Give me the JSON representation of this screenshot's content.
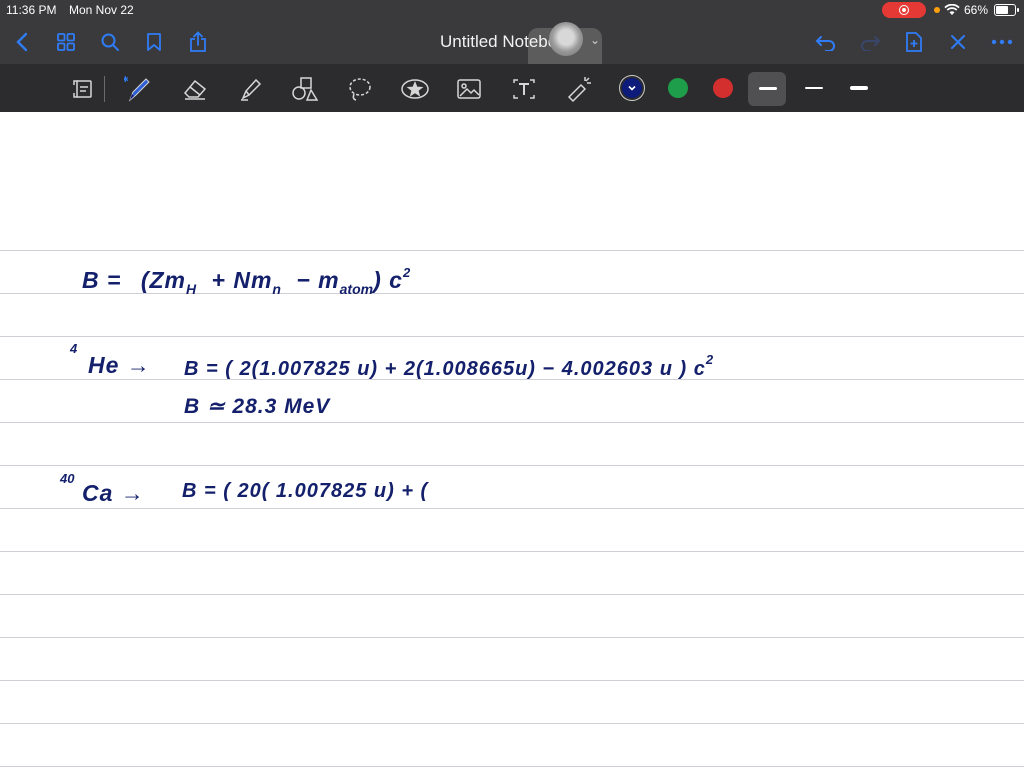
{
  "status_bar": {
    "time": "11:36 PM",
    "date": "Mon Nov 22",
    "battery": "66%"
  },
  "nav": {
    "title": "Untitled Notebook",
    "icons": [
      "chevron-left-icon",
      "grid-icon",
      "search-icon",
      "bookmark-icon",
      "share-icon",
      "undo-icon",
      "redo-icon",
      "add-page-icon",
      "close-icon",
      "more-icon"
    ]
  },
  "toolbar": {
    "tools": [
      "scan-icon",
      "pen-icon",
      "eraser-icon",
      "highlighter-icon",
      "shapes-icon",
      "lasso-icon",
      "sticker-icon",
      "image-icon",
      "text-icon",
      "laser-pointer-icon"
    ],
    "colors": [
      "#0d1b7a",
      "#1e9e4a",
      "#d32f2f"
    ],
    "stroke_sizes": [
      "thin",
      "medium",
      "thick"
    ]
  },
  "notes": {
    "line1": {
      "lhs": "B =",
      "expr_a": "(Zm",
      "sub_h": "H",
      "expr_b": "+ Nm",
      "sub_n": "n",
      "expr_c": "− m",
      "sub_atom": "atom",
      "expr_d": ") c",
      "sup_2": "2"
    },
    "line2": {
      "pre_sup": "4",
      "element": "He →",
      "eq": "B = ( 2(1.007825 u) + 2(1.008665u) − 4.002603 u ) c",
      "sup_2": "2"
    },
    "line3": {
      "text": "B ≃  28.3 MeV"
    },
    "line4": {
      "pre_sup": "40",
      "element": "Ca →",
      "eq": "B = ( 20( 1.007825 u) +  ("
    }
  }
}
